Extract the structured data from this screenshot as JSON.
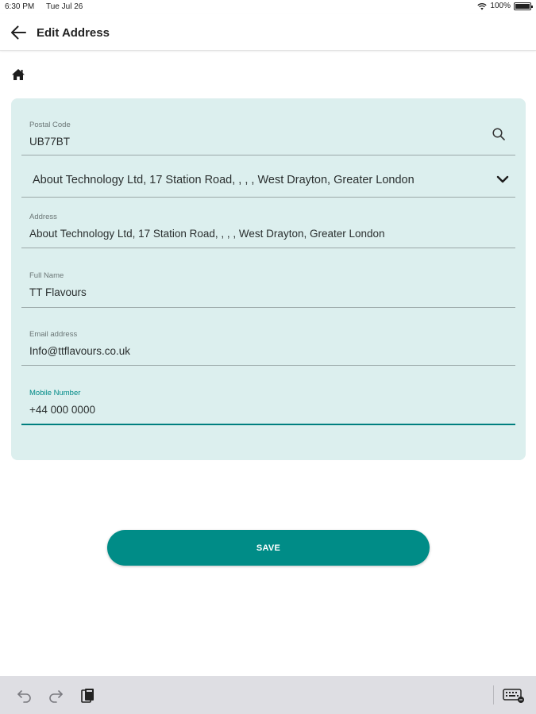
{
  "status_bar": {
    "time": "6:30 PM",
    "date": "Tue Jul 26",
    "battery": "100%"
  },
  "header": {
    "title": "Edit Address"
  },
  "form": {
    "postal_code": {
      "label": "Postal Code",
      "value": "UB77BT"
    },
    "address_select": {
      "value": "About Technology Ltd, 17 Station Road, , , , West Drayton, Greater London"
    },
    "address": {
      "label": "Address",
      "value": "About Technology Ltd, 17 Station Road, , , , West Drayton, Greater London"
    },
    "full_name": {
      "label": "Full Name",
      "value": "TT Flavours"
    },
    "email": {
      "label": "Email address",
      "value": "Info@ttflavours.co.uk"
    },
    "mobile": {
      "label": "Mobile Number",
      "value": "+44 000 0000"
    }
  },
  "actions": {
    "save_label": "SAVE"
  },
  "icons": [
    "back-arrow-icon",
    "home-icon",
    "search-icon",
    "chevron-down-icon",
    "undo-icon",
    "redo-icon",
    "clipboard-icon",
    "keyboard-icon",
    "wifi-icon",
    "battery-icon"
  ],
  "colors": {
    "accent": "#008c87",
    "card_background": "#dcefee",
    "active_underline": "#007f7f"
  }
}
